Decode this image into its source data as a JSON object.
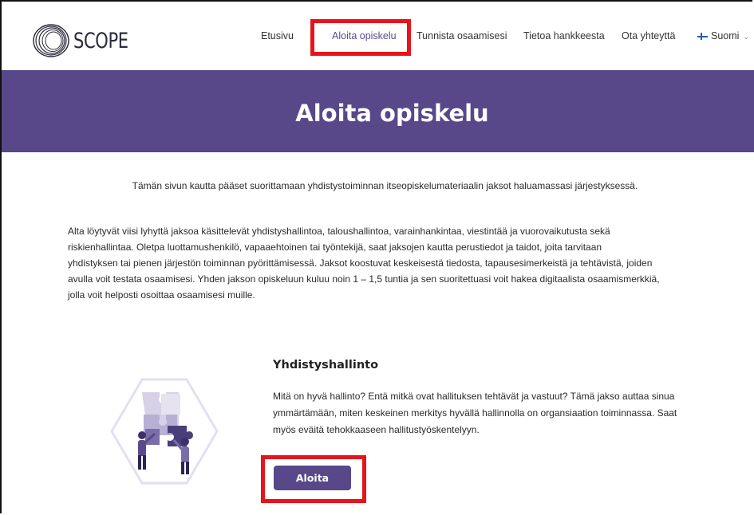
{
  "brand": {
    "logo_text": "SCOPE",
    "accent_color": "#594889",
    "highlight_color": "#e8141b"
  },
  "nav": {
    "items": [
      {
        "label": "Etusivu"
      },
      {
        "label": "Aloita opiskelu",
        "active": true
      },
      {
        "label": "Tunnista osaamisesi"
      },
      {
        "label": "Tietoa hankkeesta"
      },
      {
        "label": "Ota yhteyttä"
      }
    ],
    "language": {
      "label": "Suomi",
      "icon": "finnish-flag-icon"
    }
  },
  "hero": {
    "title": "Aloita opiskelu"
  },
  "content": {
    "intro": "Tämän sivun kautta pääset suorittamaan yhdistystoiminnan itseopiskelumateriaalin jaksot haluamassasi järjestyksessä.",
    "paragraph_lines": [
      "Alta löytyvät viisi lyhyttä jaksoa käsittelevät yhdistyshallintoa, taloushallintoa, varainhankintaa, viestintää ja vuorovaikutusta sekä",
      "riskienhallintaa. Oletpa luottamushenkilö, vapaaehtoinen tai työntekijä, saat jaksojen kautta perustiedot ja taidot, joita tarvitaan",
      "yhdistyksen tai pienen järjestön toiminnan pyörittämisessä. Jaksot koostuvat keskeisestä tiedosta, tapausesimerkeistä ja tehtävistä, joiden",
      "avulla voit testata osaamisesi. Yhden jakson opiskeluun kuluu noin 1 – 1,5 tuntia ja sen suoritettuasi voit hakea digitaalista osaamismerkkiä,",
      "jolla voit helposti osoittaa osaamisesi muille."
    ]
  },
  "section": {
    "title": "Yhdistyshallinto",
    "description_lines": [
      "Mitä on hyvä hallinto? Entä mitkä ovat hallituksen tehtävät ja vastuut? Tämä jakso auttaa sinua",
      "ymmärtämään, miten keskeinen merkitys hyvällä hallinnolla on organsiaation toiminnassa. Saat",
      "myös eväitä tehokkaaseen hallitustyöskentelyyn."
    ],
    "button_label": "Aloita",
    "illustration_icon": "puzzle-people-hexagon-icon"
  }
}
